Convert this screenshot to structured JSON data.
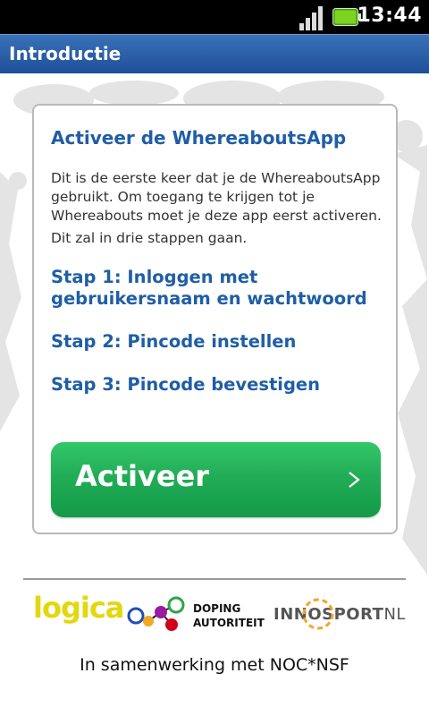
{
  "status_bar": {
    "time": "13:44"
  },
  "title_bar": {
    "title": "Introductie"
  },
  "card": {
    "title": "Activeer de WhereaboutsApp",
    "paragraph1": "Dit is de eerste keer dat je de WhereaboutsApp gebruikt. Om toegang te krijgen tot je Whereabouts moet je deze app eerst activeren.",
    "paragraph2": "Dit zal in drie stappen gaan.",
    "steps": [
      "Stap 1: Inloggen met gebruikersnaam en wachtwoord",
      "Stap 2: Pincode instellen",
      "Stap 3: Pincode bevestigen"
    ],
    "activate_button": "Activeer"
  },
  "footer": {
    "logos": {
      "logica": "logica",
      "doping_line1": "DOPING",
      "doping_line2": "AUTORITEIT",
      "innosport_a": "INN",
      "innosport_b": "SPORT",
      "innosport_c": "NL"
    },
    "collaboration": "In samenwerking met NOC*NSF"
  },
  "colors": {
    "title_bar": "#2a5fa8",
    "heading_blue": "#1f5ea6",
    "button_green": "#21ad56",
    "logica_yellow": "#e3d70f"
  },
  "icons": [
    "signal-icon",
    "battery-icon",
    "chevron-right-icon",
    "doping-autoriteit-logo",
    "innosport-ring-icon"
  ]
}
